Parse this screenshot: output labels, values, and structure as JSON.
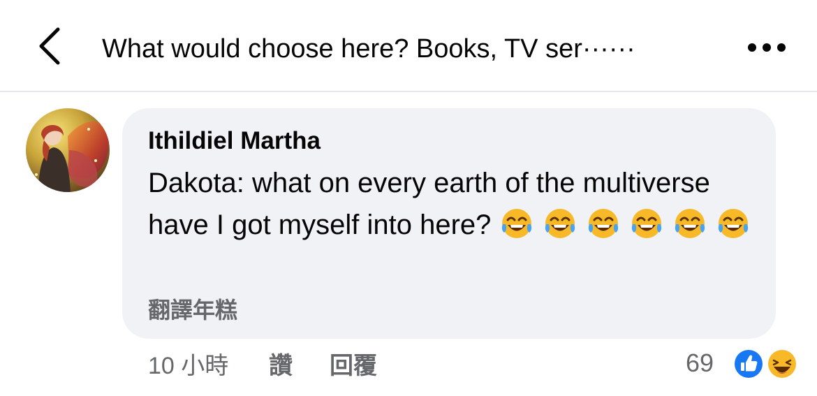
{
  "header": {
    "back_icon": "chevron-left-icon",
    "title": "What would choose here? Books, TV ser······",
    "more_icon": "more-horizontal-icon"
  },
  "comment": {
    "author": "Ithildiel Martha",
    "text": "Dakota: what on every earth of the multiverse have I got myself into here?",
    "emoji_icon": "face-with-tears-of-joy-icon",
    "emoji_count": 6,
    "translate_label": "翻譯年糕",
    "time": "10 小時",
    "like_label": "讚",
    "reply_label": "回覆",
    "reaction_count": "69",
    "reaction_icons": [
      "like-reaction-icon",
      "haha-reaction-icon"
    ]
  },
  "colors": {
    "bubble": "#f0f2f5",
    "secondary_text": "#65676b",
    "like_blue": "#1877f2",
    "emoji_yellow": "#f7b928"
  }
}
